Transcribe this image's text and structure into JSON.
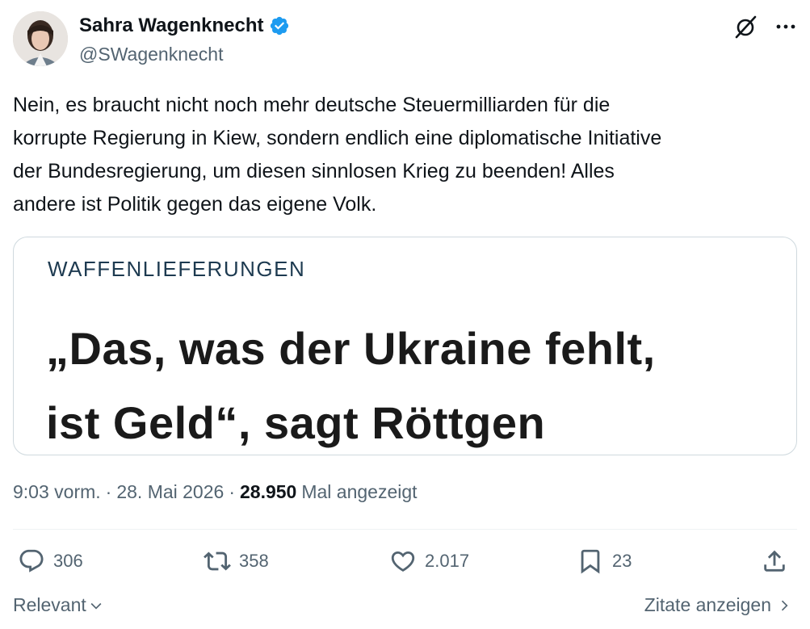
{
  "author": {
    "name": "Sahra Wagenknecht",
    "handle": "@SWagenknecht",
    "verified_color": "#1d9bf0"
  },
  "header_icons": [
    "grok-icon",
    "more-icon"
  ],
  "tweet": {
    "text_lines": [
      "Nein, es braucht nicht noch mehr deutsche Steuermilliarden für die",
      "korrupte Regierung in Kiew, sondern endlich eine diplomatische Initiative",
      "der Bundesregierung, um diesen sinnlosen Krieg zu beenden! Alles",
      "andere ist Politik gegen das eigene Volk."
    ]
  },
  "card": {
    "kicker": "WAFFENLIEFERUNGEN",
    "headline_line1": "„Das, was der Ukraine fehlt,",
    "headline_line2": "ist Geld“, sagt Röttgen"
  },
  "meta": {
    "time": "9:03 vorm.",
    "separator": "·",
    "date": "28. Mai 2026",
    "views_count": "28.950",
    "views_label": "Mal angezeigt"
  },
  "actions": {
    "replies": "306",
    "retweets": "358",
    "likes": "2.017",
    "bookmarks": "23"
  },
  "footer": {
    "sort_label": "Relevant",
    "quotes_label": "Zitate anzeigen"
  },
  "colors": {
    "text": "#0f1419",
    "secondary": "#536471",
    "border": "#cfd9de",
    "accent": "#1d9bf0"
  }
}
